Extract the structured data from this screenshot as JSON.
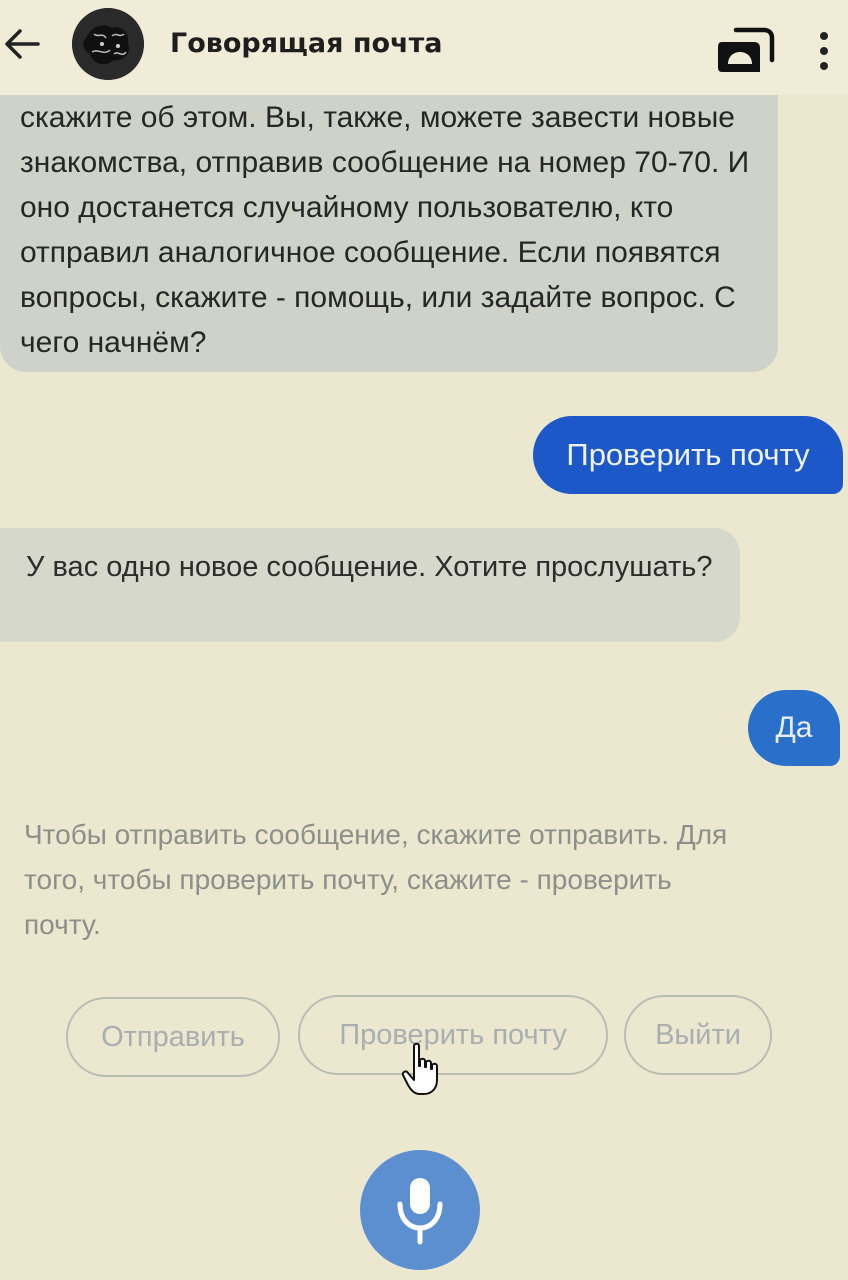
{
  "header": {
    "title": "Говорящая почта",
    "back_icon": "arrow-left-icon",
    "switch_icon": "switch-device-icon",
    "menu_icon": "more-vertical-icon"
  },
  "messages": {
    "bot_intro": "скажите об этом. Вы, также, можете завести новые знакомства, отправив сообщение на номер 70-70. И оно достанется случайному пользователю, кто отправил аналогичное сообщение. Если появятся вопросы, скажите - помощь, или задайте вопрос. С чего начнём?",
    "user_check_mail": "Проверить почту",
    "bot_new_message": "У вас одно новое сообщение. Хотите прослушать?",
    "user_yes": "Да",
    "bot_hint": "Чтобы отправить сообщение, скажите отправить. Для того, чтобы проверить почту, скажите - проверить почту."
  },
  "suggestions": {
    "send": "Отправить",
    "check_mail": "Проверить почту",
    "exit": "Выйти"
  },
  "mic": {
    "icon": "microphone-icon"
  },
  "colors": {
    "background": "#ece7cf",
    "user_bubble": "#1c58c7",
    "bot_bubble": "#cfd2c8",
    "mic_button": "#5b8fcf"
  }
}
